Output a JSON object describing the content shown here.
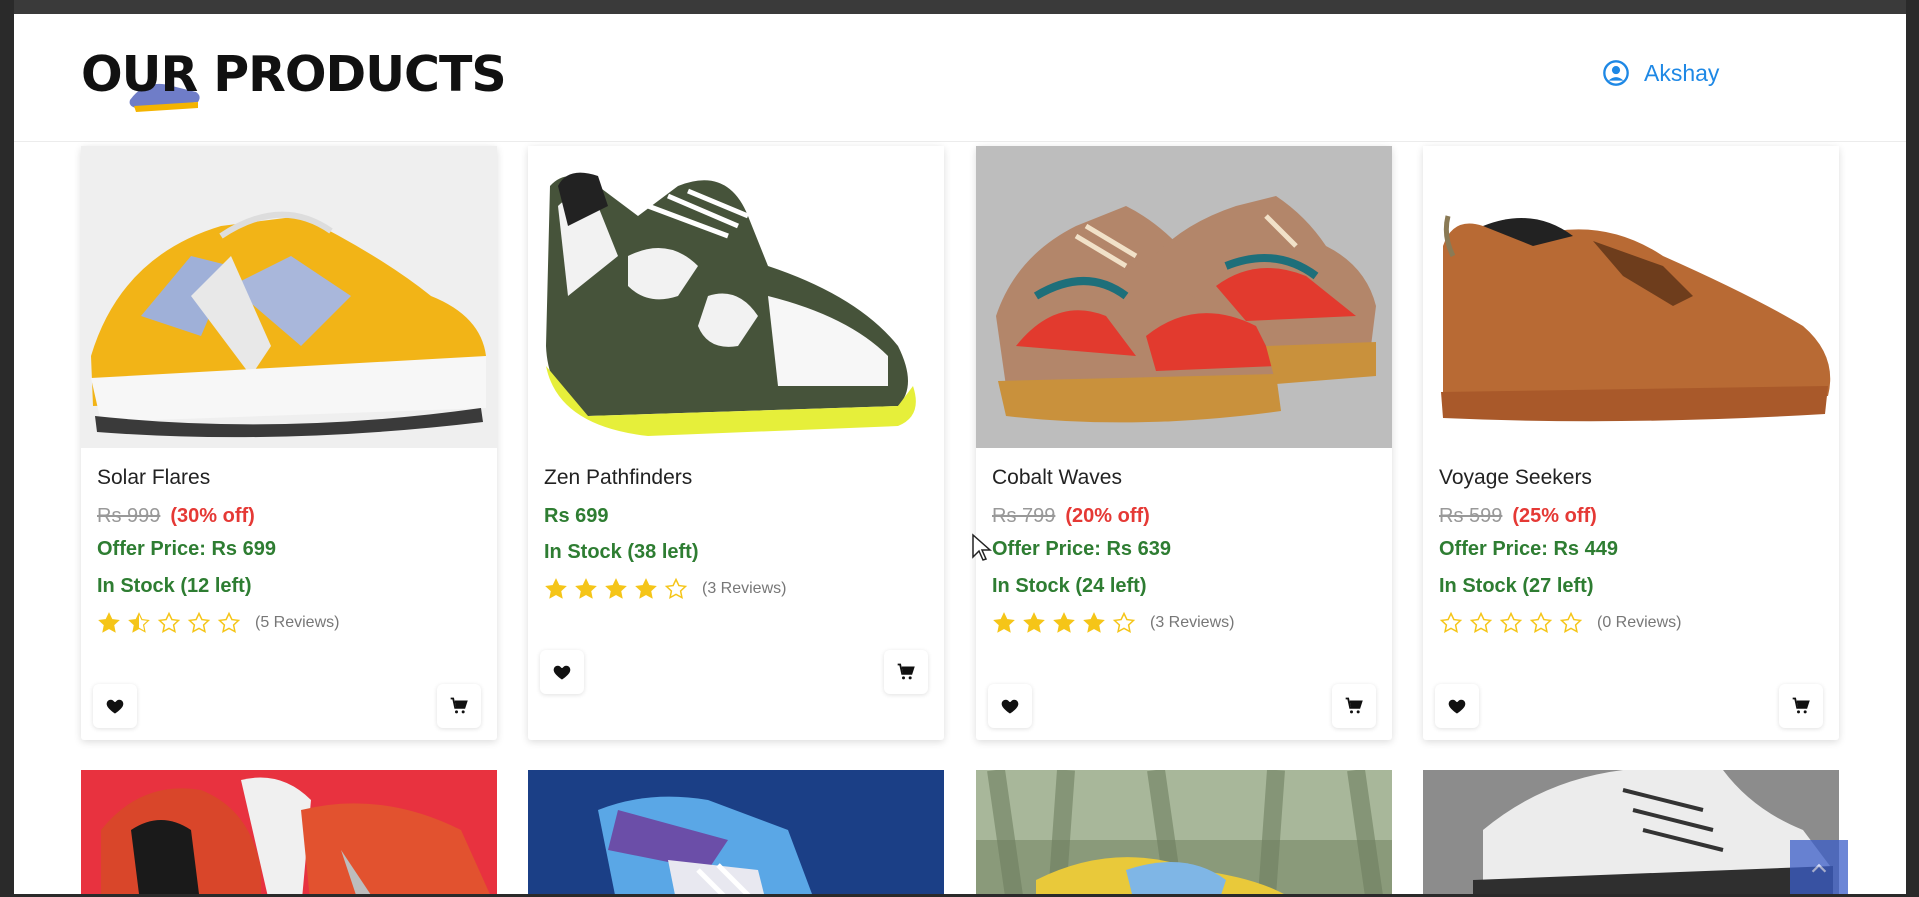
{
  "header": {
    "title": "OUR PRODUCTS",
    "user_name": "Akshay"
  },
  "products": [
    {
      "name": "Solar Flares",
      "mrp": "Rs 999",
      "discount": "(30% off)",
      "offer": "Offer Price: Rs 699",
      "stock": "In Stock (12 left)",
      "rating": 1.5,
      "reviews": "(5 Reviews)"
    },
    {
      "name": "Zen Pathfinders",
      "price": "Rs 699",
      "stock": "In Stock (38 left)",
      "rating": 4,
      "reviews": "(3 Reviews)"
    },
    {
      "name": "Cobalt Waves",
      "mrp": "Rs 799",
      "discount": "(20% off)",
      "offer": "Offer Price: Rs 639",
      "stock": "In Stock (24 left)",
      "rating": 4,
      "reviews": "(3 Reviews)"
    },
    {
      "name": "Voyage Seekers",
      "mrp": "Rs 599",
      "discount": "(25% off)",
      "offer": "Offer Price: Rs 449",
      "stock": "In Stock (27 left)",
      "rating": 0,
      "reviews": "(0 Reviews)"
    }
  ],
  "icons": {
    "user": "user-circle-icon",
    "wishlist": "heart-icon",
    "cart": "cart-icon",
    "star": "star-icon",
    "back_to_top": "chevron-up-icon"
  },
  "colors": {
    "accent": "#1e88e5",
    "discount": "#e53935",
    "in_stock": "#2e7d32",
    "star": "#f5c518"
  }
}
